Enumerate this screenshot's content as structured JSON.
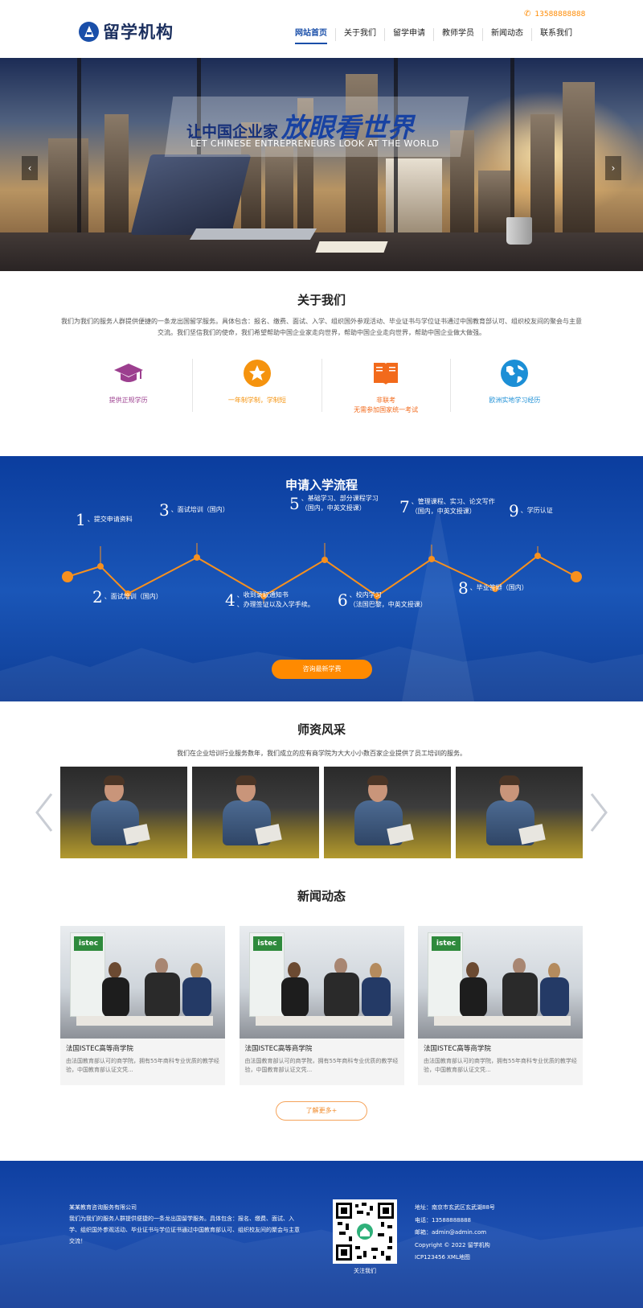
{
  "header": {
    "logo_text": "留学机构",
    "phone": "13588888888",
    "nav": [
      "网站首页",
      "关于我们",
      "留学申请",
      "教师学员",
      "新闻动态",
      "联系我们"
    ]
  },
  "banner": {
    "title_a": "让中国企业家",
    "title_b": "放眼看世界",
    "subtitle": "LET CHINESE ENTREPRENEURS LOOK AT THE WORLD",
    "prev": "‹",
    "next": "›"
  },
  "about": {
    "title": "关于我们",
    "desc": "我们为我们的服务人群提供便捷的一条龙出国留学服务。具体包含：报名、缴费、面试、入学、组织国外参观活动、毕业证书与学位证书通过中国教育部认可、组织校友间的聚会与主意交流。我们坚信我们的使命，我们希望帮助中国企业家走向世界，帮助中国企业走向世界，帮助中国企业做大做强。",
    "features": [
      {
        "icon": "graduation-cap-icon",
        "color": "#9c3f8f",
        "lines": [
          "提供正规学历"
        ]
      },
      {
        "icon": "star-badge-icon",
        "color": "#f5930e",
        "lines": [
          "一年制学制，学制短"
        ]
      },
      {
        "icon": "book-icon",
        "color": "#f26a1b",
        "lines": [
          "非联考",
          "无需参加国家统一考试"
        ]
      },
      {
        "icon": "globe-icon",
        "color": "#1c8fd6",
        "lines": [
          "欧洲实地学习经历"
        ]
      }
    ]
  },
  "process": {
    "title": "申请入学流程",
    "steps": [
      {
        "num": "1",
        "lines": [
          "、提交申请资料"
        ]
      },
      {
        "num": "2",
        "lines": [
          "、面试培训（国内）"
        ]
      },
      {
        "num": "3",
        "lines": [
          "、面试培训（国内）"
        ]
      },
      {
        "num": "4",
        "lines": [
          "、收到录取通知书",
          "、办理签证以及入学手续。"
        ]
      },
      {
        "num": "5",
        "lines": [
          "、基础学习、部分课程学习",
          "（国内，中英文授课）"
        ]
      },
      {
        "num": "6",
        "lines": [
          "、校内学习",
          "（法国巴黎，中英文授课）"
        ]
      },
      {
        "num": "7",
        "lines": [
          "、管理课程、实习、论文写作",
          "（国内，中英文授课）"
        ]
      },
      {
        "num": "8",
        "lines": [
          "、毕业答辩（国内）"
        ]
      },
      {
        "num": "9",
        "lines": [
          "、学历认证"
        ]
      }
    ],
    "button": "咨询最新学费"
  },
  "teachers": {
    "title": "师资风采",
    "desc": "我们在企业培训行业服务数年，我们成立的应有商学院为大大小小数百家企业提供了员工培训的服务。",
    "count": 4
  },
  "news": {
    "title": "新闻动态",
    "items": [
      {
        "title": "法国ISTEC高等商学院",
        "text": "由法国教育部认可的商学院，拥有55年商科专业优质的教学经验，中国教育部认证文凭...",
        "logo": "istec"
      },
      {
        "title": "法国ISTEC高等商学院",
        "text": "由法国教育部认可的商学院，拥有55年商科专业优质的教学经验，中国教育部认证文凭...",
        "logo": "istec"
      },
      {
        "title": "法国ISTEC高等商学院",
        "text": "由法国教育部认可的商学院，拥有55年商科专业优质的教学经验，中国教育部认证文凭...",
        "logo": "istec"
      }
    ],
    "more": "了解更多+"
  },
  "footer": {
    "company": "某某教育咨询服务有限公司",
    "desc": "我们为我们的服务人群提供便捷的一条龙出国留学服务。具体包含：报名、缴费、面试、入学、组织国外参观活动、毕业证书与学位证书通过中国教育部认可、组织校友间的聚会与主意交流！",
    "qr_caption": "关注我们",
    "address": "地址：南京市玄武区玄武湖88号",
    "phone": "电话：13588888888",
    "email": "邮箱：admin@admin.com",
    "copyright": "Copyright © 2022 留学机构",
    "icp": "ICP123456 XML地图"
  },
  "colors": {
    "brand_blue": "#1a4fa9",
    "accent_orange": "#ff8a00"
  }
}
